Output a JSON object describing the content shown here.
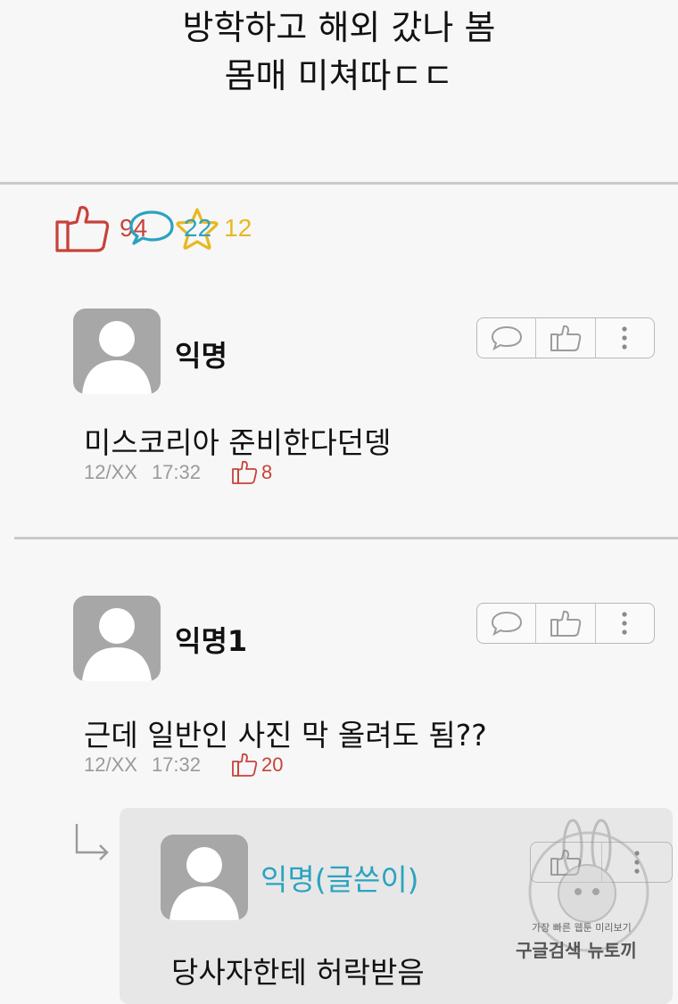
{
  "post": {
    "title_line1": "방학하고 해외 갔나 봄",
    "title_line2": "몸매 미쳐따ㄷㄷ"
  },
  "stats": {
    "likes": "94",
    "comments": "22",
    "stars": "12"
  },
  "comments": [
    {
      "author": "익명",
      "text": "미스코리아 준비한다던뎅",
      "date": "12/XX",
      "time": "17:32",
      "likes": "8"
    },
    {
      "author": "익명1",
      "text": "근데 일반인 사진 막 올려도 됨??",
      "date": "12/XX",
      "time": "17:32",
      "likes": "20"
    }
  ],
  "reply": {
    "author": "익명(글쓴이)",
    "text": "당사자한테 허락받음"
  },
  "watermark": {
    "line1": "가장 빠른 웹툰 미리보기",
    "line2": "구글검색 뉴토끼"
  },
  "colors": {
    "like": "#c8423a",
    "comment": "#2aa3c0",
    "star": "#e8b820",
    "author_writer": "#2aa3c0"
  }
}
